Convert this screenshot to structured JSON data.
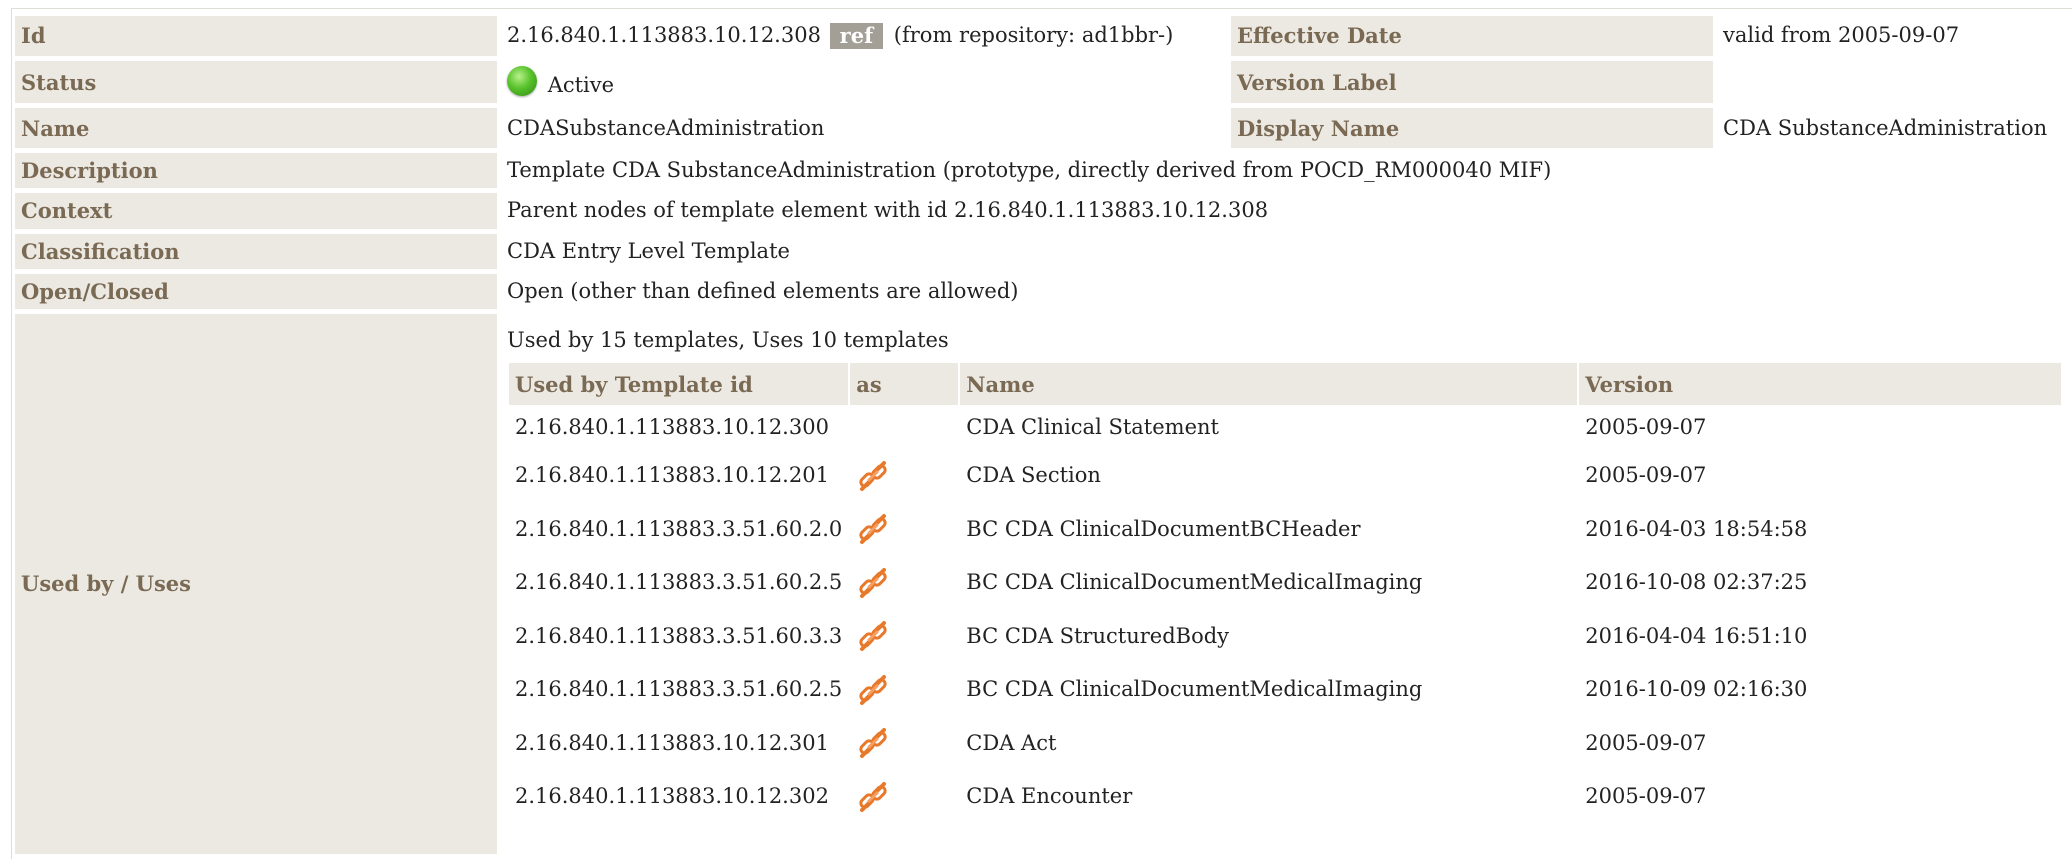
{
  "details": {
    "id_label": "Id",
    "id_value": "2.16.840.1.113883.10.12.308",
    "ref_badge": "ref",
    "repository_text": "(from repository: ad1bbr-)",
    "effective_date_label": "Effective Date",
    "effective_date_value": "valid from 2005-09-07",
    "status_label": "Status",
    "status_value": "Active",
    "version_label_label": "Version Label",
    "version_label_value": "",
    "name_label": "Name",
    "name_value": "CDASubstanceAdministration",
    "display_name_label": "Display Name",
    "display_name_value": "CDA SubstanceAdministration",
    "description_label": "Description",
    "description_value": "Template CDA SubstanceAdministration (prototype, directly derived from POCD_RM000040 MIF)",
    "context_label": "Context",
    "context_value": "Parent nodes of template element with id 2.16.840.1.113883.10.12.308",
    "classification_label": "Classification",
    "classification_value": "CDA Entry Level Template",
    "open_closed_label": "Open/Closed",
    "open_closed_value": "Open (other than defined elements are allowed)",
    "used_by_label": "Used by / Uses"
  },
  "used_by": {
    "summary": "Used by 15 templates, Uses 10 templates",
    "columns": [
      "Used by Template id",
      "as",
      "Name",
      "Version"
    ],
    "rows": [
      {
        "template_id": "2.16.840.1.113883.10.12.300",
        "as_icon": "",
        "name": "CDA Clinical Statement",
        "version": "2005-09-07"
      },
      {
        "template_id": "2.16.840.1.113883.10.12.201",
        "as_icon": "link-icon",
        "name": "CDA Section",
        "version": "2005-09-07"
      },
      {
        "template_id": "2.16.840.1.113883.3.51.60.2.0",
        "as_icon": "link-icon",
        "name": "BC CDA ClinicalDocumentBCHeader",
        "version": "2016-04-03 18:54:58"
      },
      {
        "template_id": "2.16.840.1.113883.3.51.60.2.5",
        "as_icon": "link-icon",
        "name": "BC CDA ClinicalDocumentMedicalImaging",
        "version": "2016-10-08 02:37:25"
      },
      {
        "template_id": "2.16.840.1.113883.3.51.60.3.3",
        "as_icon": "link-icon",
        "name": "BC CDA StructuredBody",
        "version": "2016-04-04 16:51:10"
      },
      {
        "template_id": "2.16.840.1.113883.3.51.60.2.5",
        "as_icon": "link-icon",
        "name": "BC CDA ClinicalDocumentMedicalImaging",
        "version": "2016-10-09 02:16:30"
      },
      {
        "template_id": "2.16.840.1.113883.10.12.301",
        "as_icon": "link-icon",
        "name": "CDA Act",
        "version": "2005-09-07"
      },
      {
        "template_id": "2.16.840.1.113883.10.12.302",
        "as_icon": "link-icon",
        "name": "CDA Encounter",
        "version": "2005-09-07"
      }
    ]
  },
  "colors": {
    "label_bg": "#ece9e3",
    "label_text": "#7a6a54",
    "ref_badge_bg": "#a39e96",
    "status_active": "#58c22c",
    "link_icon": "#e8792b"
  }
}
